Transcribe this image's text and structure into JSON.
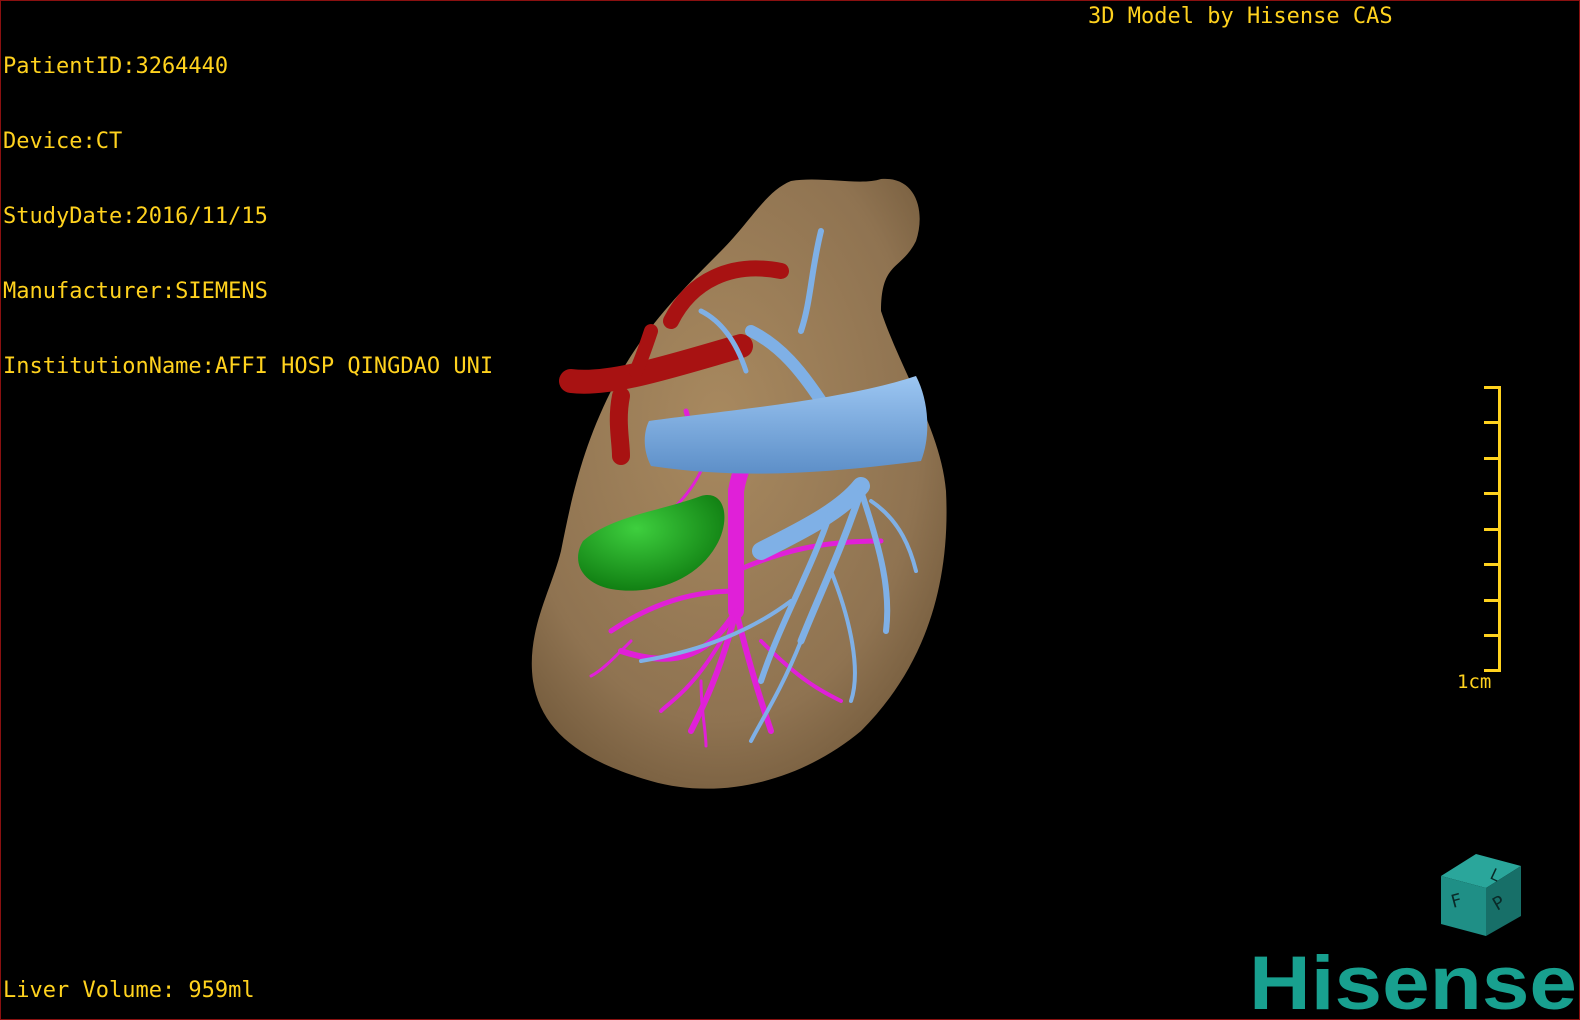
{
  "info": {
    "patient_id": "PatientID:3264440",
    "device": "Device:CT",
    "study_date": "StudyDate:2016/11/15",
    "manufacturer": "Manufacturer:SIEMENS",
    "institution": "InstitutionName:AFFI HOSP QINGDAO UNI"
  },
  "brand_line": "3D Model by Hisense CAS",
  "liver_volume": "Liver Volume: 959ml",
  "scale": {
    "label": "1cm",
    "ticks": 9
  },
  "orientation_cube": {
    "faces": [
      "F",
      "L",
      "P"
    ],
    "color": "#1f8f86"
  },
  "logo": {
    "text": "Hisense",
    "color": "#18a08f"
  },
  "colors": {
    "overlay_text": "#ffd21e",
    "liver": "#8f7351",
    "artery": "#a81212",
    "vena_cava": "#7fb0e6",
    "portal_vein": "#e020d8",
    "gallbladder": "#1ca01c"
  }
}
